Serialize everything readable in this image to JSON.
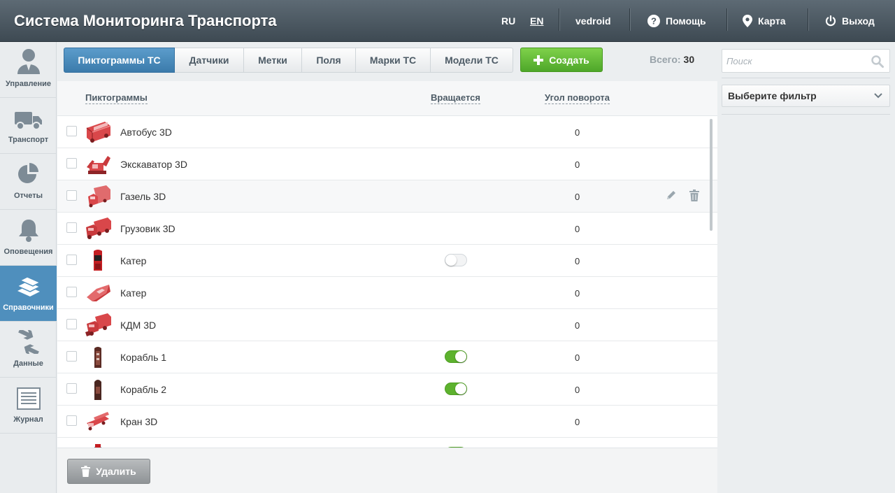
{
  "header": {
    "title": "Система Мониторинга Транспорта",
    "lang_ru": "RU",
    "lang_en": "EN",
    "user": "vedroid",
    "help": "Помощь",
    "map": "Карта",
    "logout": "Выход"
  },
  "sidebar": {
    "items": [
      {
        "label": "Управление",
        "icon": "user-icon"
      },
      {
        "label": "Транспорт",
        "icon": "truck-icon"
      },
      {
        "label": "Отчеты",
        "icon": "pie-chart-icon"
      },
      {
        "label": "Оповещения",
        "icon": "bell-icon"
      },
      {
        "label": "Справочники",
        "icon": "books-icon",
        "active": true
      },
      {
        "label": "Данные",
        "icon": "exchange-icon"
      },
      {
        "label": "Журнал",
        "icon": "journal-icon"
      }
    ]
  },
  "tabs": [
    "Пиктограммы ТС",
    "Датчики",
    "Метки",
    "Поля",
    "Марки ТС",
    "Модели ТС"
  ],
  "create_label": "Создать",
  "total_label": "Всего:",
  "total_value": "30",
  "columns": {
    "icons": "Пиктограммы",
    "rotates": "Вращается",
    "angle": "Угол поворота"
  },
  "rows": [
    {
      "name": "Автобус 3D",
      "angle": "0",
      "rotates": null,
      "icon": "bus-icon"
    },
    {
      "name": "Экскаватор 3D",
      "angle": "0",
      "rotates": null,
      "icon": "excavator-icon"
    },
    {
      "name": "Газель 3D",
      "angle": "0",
      "rotates": null,
      "icon": "van-icon"
    },
    {
      "name": "Грузовик 3D",
      "angle": "0",
      "rotates": null,
      "icon": "truck-3d-icon"
    },
    {
      "name": "Катер",
      "angle": "0",
      "rotates": false,
      "icon": "boat-topdown-icon"
    },
    {
      "name": "Катер",
      "angle": "0",
      "rotates": null,
      "icon": "boat-3d-icon"
    },
    {
      "name": "КДМ 3D",
      "angle": "0",
      "rotates": null,
      "icon": "kdm-icon"
    },
    {
      "name": "Корабль 1",
      "angle": "0",
      "rotates": true,
      "icon": "ship-1-icon"
    },
    {
      "name": "Корабль 2",
      "angle": "0",
      "rotates": true,
      "icon": "ship-2-icon"
    },
    {
      "name": "Кран 3D",
      "angle": "0",
      "rotates": null,
      "icon": "crane-icon"
    },
    {
      "name": "",
      "angle": "",
      "rotates": true,
      "icon": "partial-icon"
    }
  ],
  "delete_label": "Удалить",
  "search_placeholder": "Поиск",
  "filter_label": "Выберите фильтр",
  "colors": {
    "header": "#4b5760",
    "active_tab": "#4a8cbd",
    "create_button": "#62bd37",
    "toggle_on": "#5db22e",
    "icon_red": "#d9474a"
  }
}
